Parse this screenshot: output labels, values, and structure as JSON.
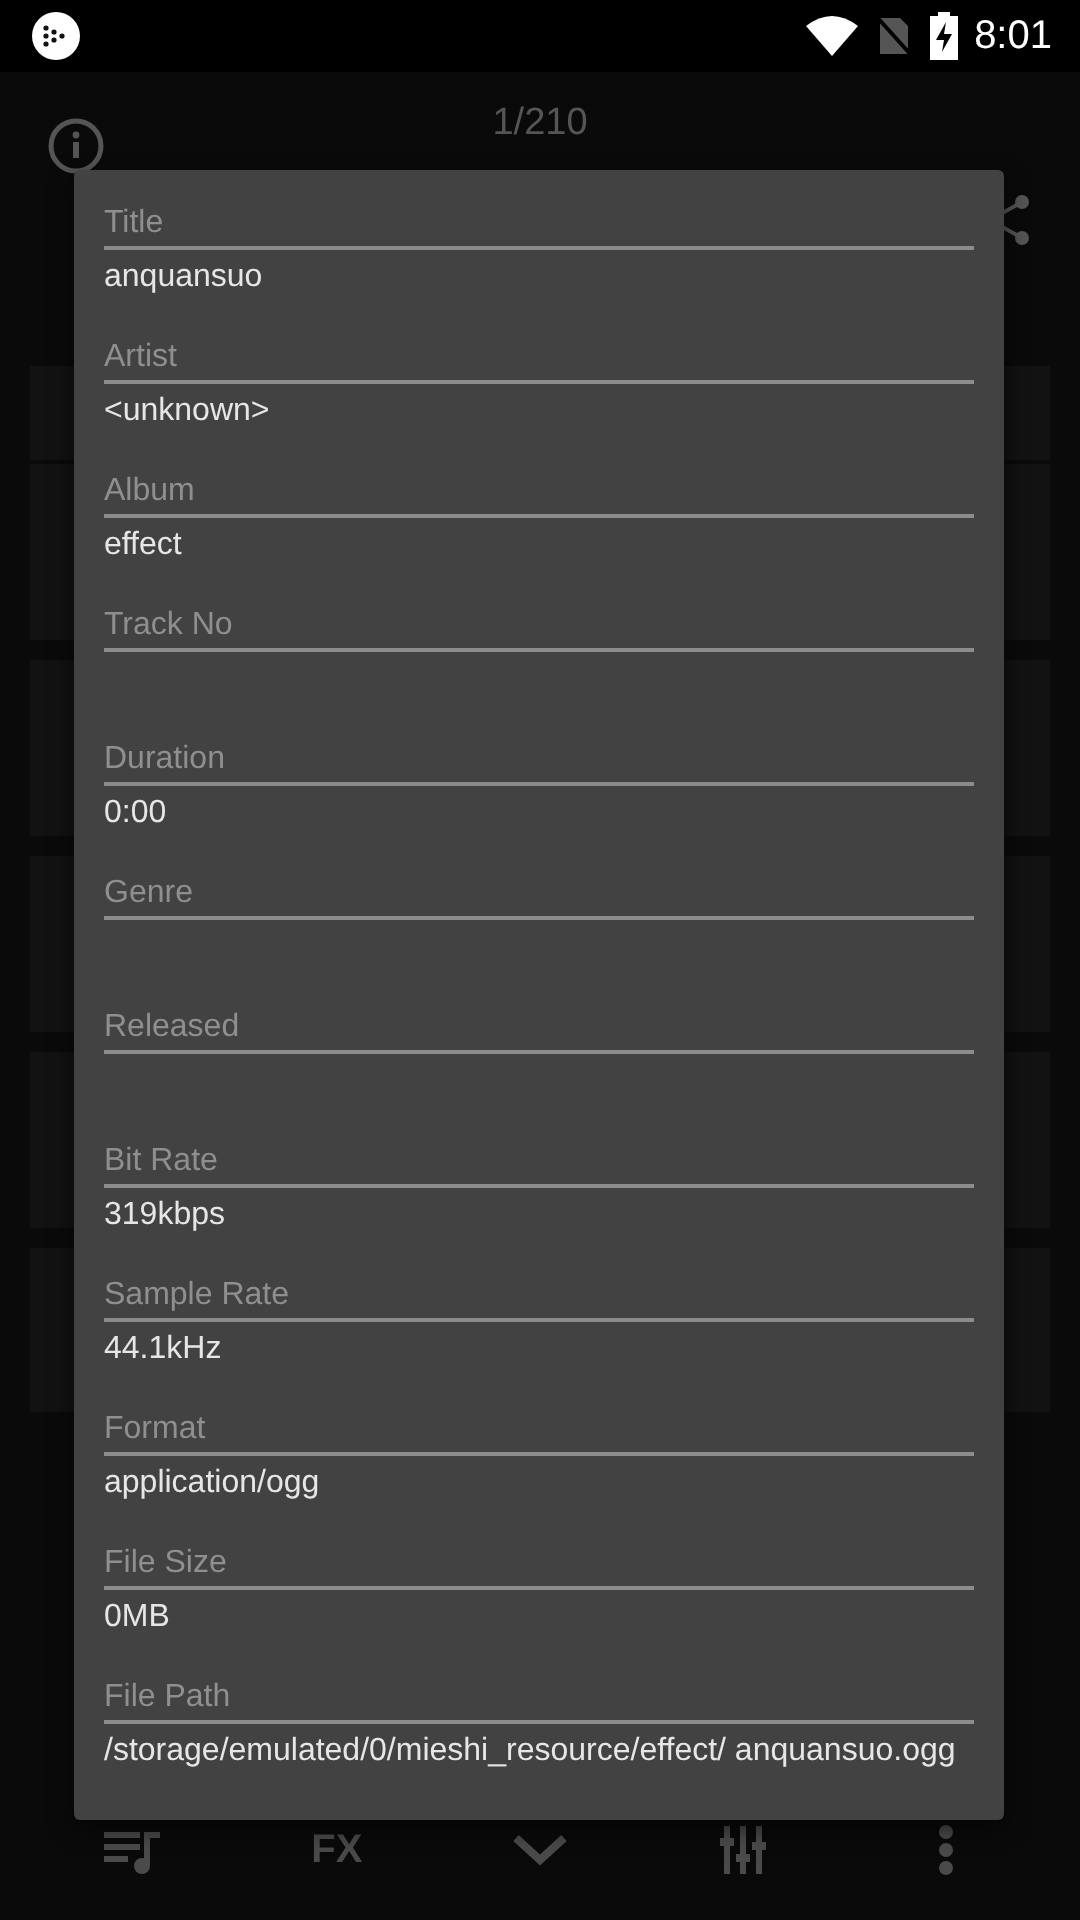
{
  "status_bar": {
    "time": "8:01"
  },
  "header": {
    "counter": "1/210"
  },
  "dialog": {
    "fields": [
      {
        "label": "Title",
        "value": "anquansuo"
      },
      {
        "label": "Artist",
        "value": "<unknown>"
      },
      {
        "label": "Album",
        "value": "effect"
      },
      {
        "label": "Track No"
      },
      {
        "label": "Duration",
        "value": "0:00"
      },
      {
        "label": "Genre"
      },
      {
        "label": "Released"
      },
      {
        "label": "Bit Rate",
        "value": "319kbps"
      },
      {
        "label": "Sample Rate",
        "value": "44.1kHz"
      },
      {
        "label": "Format",
        "value": "application/ogg"
      },
      {
        "label": "File Size",
        "value": "0MB"
      },
      {
        "label": "File Path",
        "value": "/storage/emulated/0/mieshi_resource/effect/ anquansuo.ogg"
      }
    ]
  },
  "bottom_bar": {
    "items": [
      {
        "kind": "queue"
      },
      {
        "kind": "text",
        "label": "FX"
      },
      {
        "kind": "collapse"
      },
      {
        "kind": "equalizer"
      },
      {
        "kind": "more"
      }
    ]
  }
}
